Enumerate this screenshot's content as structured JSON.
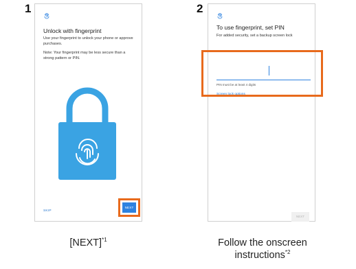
{
  "step1": {
    "number": "1",
    "title": "Unlock with fingerprint",
    "description": "Use your fingerprint to unlock your phone or approve purchases.",
    "note": "Note: Your fingerprint may be less secure than a strong pattern or PIN.",
    "skip_label": "SKIP",
    "next_label": "NEXT",
    "caption": "[NEXT]",
    "caption_note": "*1"
  },
  "step2": {
    "number": "2",
    "title": "To use fingerprint, set PIN",
    "description": "For added security, set a backup screen lock",
    "pin_value": "",
    "pin_hint": "PIN must be at least 4 digits",
    "screen_lock_options": "Screen lock options",
    "next_label": "NEXT",
    "caption_line1": "Follow the onscreen",
    "caption_line2": "instructions",
    "caption_note": "*2"
  },
  "colors": {
    "highlight": "#e86a1c",
    "accent_blue": "#2d82e0",
    "lock_blue": "#3aa3e3"
  },
  "icons": [
    "fingerprint-icon",
    "padlock-fingerprint-illustration"
  ]
}
